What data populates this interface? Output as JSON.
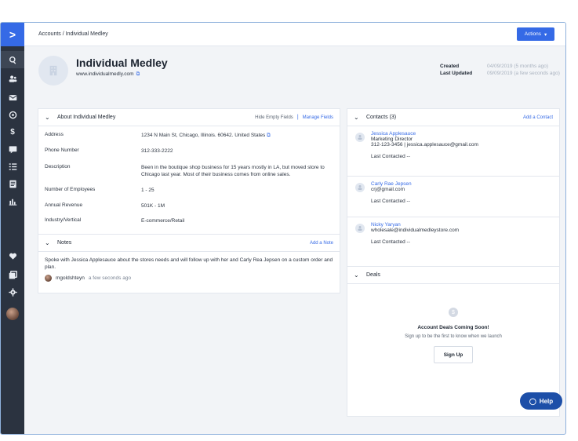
{
  "nav": {
    "logo": ">",
    "icons": [
      "search-icon",
      "contacts-icon",
      "mail-icon",
      "deals-icon",
      "dollar-icon",
      "conversations-icon",
      "list-icon",
      "document-icon",
      "reports-icon",
      "heart-icon",
      "pages-icon",
      "settings-icon",
      "user-avatar"
    ]
  },
  "header": {
    "breadcrumb": "Accounts / Individual Medley",
    "actions_label": "Actions"
  },
  "account": {
    "name": "Individual Medley",
    "website": "www.individualmedly.com",
    "created_label": "Created",
    "created_value": "04/09/2019 (5 months ago)",
    "updated_label": "Last Updated",
    "updated_value": "09/09/2019 (a few seconds ago)"
  },
  "about": {
    "title": "About Individual Medley",
    "hide_empty": "Hide Empty Fields",
    "manage_fields": "Manage Fields",
    "rows": [
      {
        "label": "Address",
        "value": "1234 N Main St, Chicago, Illinois. 60642. United States"
      },
      {
        "label": "Phone Number",
        "value": "312-333-2222"
      },
      {
        "label": "Description",
        "value": "Been in the boutique shop business for 15 years mostly in LA, but moved store to Chicago last year. Most of their business comes from online sales."
      },
      {
        "label": "Number of Employees",
        "value": "1 - 25"
      },
      {
        "label": "Annual Revenue",
        "value": "501K - 1M"
      },
      {
        "label": "Industry/Vertical",
        "value": "E-commerce/Retail"
      }
    ]
  },
  "notes": {
    "title": "Notes",
    "add_label": "Add a Note",
    "text": "Spoke with Jessica Applesauce about the stores needs and will follow up with her and Carly Rea Jepsen on a custom order and plan.",
    "author": "mgoldshteyn",
    "time": "a few seconds ago"
  },
  "contacts": {
    "title": "Contacts (3)",
    "add_label": "Add a Contact",
    "items": [
      {
        "name": "Jessica Applesauce",
        "role": "Marketing Director",
        "detail": "312-123-3456 | jessica.applesauce@gmail.com",
        "last": "Last Contacted  --"
      },
      {
        "name": "Carly Rae Jepsen",
        "role": "",
        "detail": "crj@gmail.com",
        "last": "Last Contacted  --"
      },
      {
        "name": "Nicky Yaryan",
        "role": "",
        "detail": "wholesale@individualmedleystore.com",
        "last": "Last Contacted  --"
      }
    ]
  },
  "deals": {
    "title": "Deals",
    "heading": "Account Deals Coming Soon!",
    "subtext": "Sign up to be the first to know when we launch",
    "signup_label": "Sign Up"
  },
  "help": {
    "label": "Help"
  },
  "colors": {
    "accent": "#356ae6",
    "sidebar": "#2b3340",
    "help": "#1d4fa8"
  }
}
